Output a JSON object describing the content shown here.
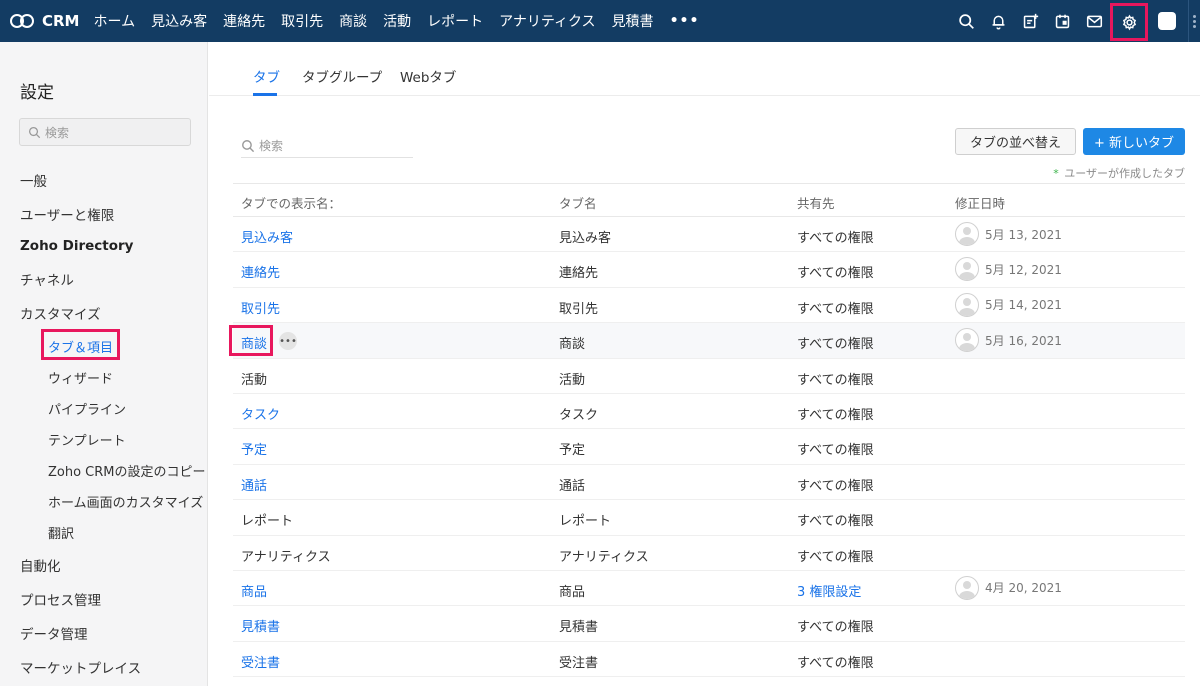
{
  "topbar": {
    "logo": "CRM",
    "nav": [
      "ホーム",
      "見込み客",
      "連絡先",
      "取引先",
      "商談",
      "活動",
      "レポート",
      "アナリティクス",
      "見積書"
    ],
    "more": "•••",
    "icons": [
      "search-icon",
      "bell-icon",
      "add-record-icon",
      "calendar-icon",
      "mail-icon",
      "gear-icon",
      "avatar"
    ]
  },
  "sidebar": {
    "title": "設定",
    "search_placeholder": "検索",
    "items": {
      "general": "一般",
      "users": "ユーザーと権限",
      "directory": "Zoho Directory",
      "channels": "チャネル",
      "customize": "カスタマイズ",
      "tabs_fields": "タブ＆項目",
      "wizard": "ウィザード",
      "pipeline": "パイプライン",
      "templates": "テンプレート",
      "copy_settings": "Zoho CRMの設定のコピー",
      "home_customize": "ホーム画面のカスタマイズ",
      "translation": "翻訳",
      "automation": "自動化",
      "process": "プロセス管理",
      "data": "データ管理",
      "marketplace": "マーケットプレイス"
    }
  },
  "main": {
    "tabs": [
      "タブ",
      "タブグループ",
      "Webタブ"
    ],
    "search_placeholder": "検索",
    "sort_button": "タブの並べ替え",
    "new_button": "+ 新しいタブ",
    "legend_star": "*",
    "legend_text": "ユーザーが作成したタブ",
    "columns": [
      "タブでの表示名：",
      "タブ名",
      "共有先",
      "修正日時"
    ],
    "rows": [
      {
        "display": "見込み客",
        "name": "見込み客",
        "shared": "すべての権限",
        "modified": "5月 13, 2021"
      },
      {
        "display": "連絡先",
        "name": "連絡先",
        "shared": "すべての権限",
        "modified": "5月 12, 2021"
      },
      {
        "display": "取引先",
        "name": "取引先",
        "shared": "すべての権限",
        "modified": "5月 14, 2021"
      },
      {
        "display": "商談",
        "name": "商談",
        "shared": "すべての権限",
        "modified": "5月 16, 2021",
        "more": "•••"
      },
      {
        "display": "活動",
        "name": "活動",
        "shared": "すべての権限",
        "modified": ""
      },
      {
        "display": "タスク",
        "name": "タスク",
        "shared": "すべての権限",
        "modified": ""
      },
      {
        "display": "予定",
        "name": "予定",
        "shared": "すべての権限",
        "modified": ""
      },
      {
        "display": "通話",
        "name": "通話",
        "shared": "すべての権限",
        "modified": ""
      },
      {
        "display": "レポート",
        "name": "レポート",
        "shared": "すべての権限",
        "modified": ""
      },
      {
        "display": "アナリティクス",
        "name": "アナリティクス",
        "shared": "すべての権限",
        "modified": ""
      },
      {
        "display": "商品",
        "name": "商品",
        "shared": "3 権限設定",
        "modified": "4月 20, 2021"
      },
      {
        "display": "見積書",
        "name": "見積書",
        "shared": "すべての権限",
        "modified": ""
      },
      {
        "display": "受注書",
        "name": "受注書",
        "shared": "すべての権限",
        "modified": ""
      }
    ]
  },
  "colors": {
    "topbar": "#133c63",
    "accent": "#1a73e8",
    "highlight": "#e8175d"
  }
}
